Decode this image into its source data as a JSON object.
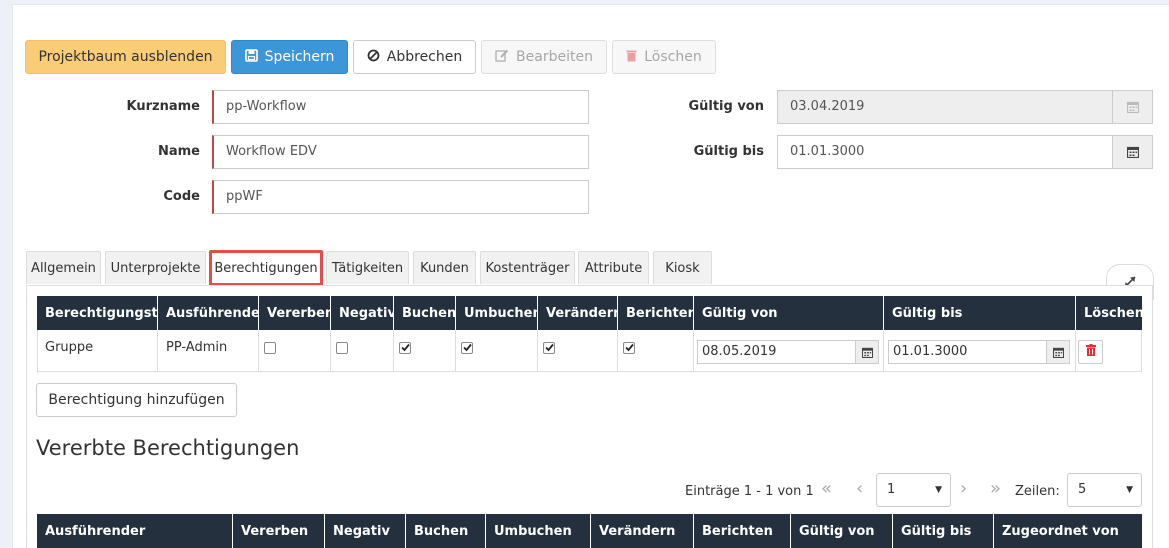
{
  "toolbar": {
    "tree_toggle": "Projektbaum ausblenden",
    "save": "Speichern",
    "cancel": "Abbrechen",
    "edit": "Bearbeiten",
    "delete": "Löschen"
  },
  "form": {
    "kurzname_label": "Kurzname",
    "kurzname_value": "pp-Workflow",
    "name_label": "Name",
    "name_value": "Workflow EDV",
    "code_label": "Code",
    "code_value": "ppWF",
    "valid_from_label": "Gültig von",
    "valid_from_value": "03.04.2019",
    "valid_to_label": "Gültig bis",
    "valid_to_value": "01.01.3000"
  },
  "tabs": [
    {
      "label": "Allgemein"
    },
    {
      "label": "Unterprojekte"
    },
    {
      "label": "Berechtigungen"
    },
    {
      "label": "Tätigkeiten"
    },
    {
      "label": "Kunden"
    },
    {
      "label": "Kostenträger"
    },
    {
      "label": "Attribute"
    },
    {
      "label": "Kiosk"
    }
  ],
  "active_tab": "Berechtigungen",
  "permissions": {
    "headers": [
      "Berechtigungstyp",
      "Ausführender",
      "Vererben",
      "Negativ",
      "Buchen",
      "Umbuchen",
      "Verändern",
      "Berichten",
      "Gültig von",
      "Gültig bis",
      "Löschen"
    ],
    "rows": [
      {
        "type": "Gruppe",
        "executor": "PP-Admin",
        "inherit": false,
        "negative": false,
        "book": true,
        "rebook": true,
        "modify": true,
        "report": true,
        "valid_from": "08.05.2019",
        "valid_to": "01.01.3000"
      }
    ],
    "add_button": "Berechtigung hinzufügen"
  },
  "inherited": {
    "title": "Vererbte Berechtigungen",
    "entries_text": "Einträge 1 - 1 von 1",
    "page_value": "1",
    "rows_label": "Zeilen:",
    "rows_value": "5",
    "headers": [
      "Ausführender",
      "Vererben",
      "Negativ",
      "Buchen",
      "Umbuchen",
      "Verändern",
      "Berichten",
      "Gültig von",
      "Gültig bis",
      "Zugeordnet von"
    ]
  },
  "colors": {
    "warning": "#f9cd75",
    "primary": "#3d96d7",
    "table_header": "#24303d",
    "active_tab_border": "#e74c4c",
    "delete_red": "#e03030"
  }
}
